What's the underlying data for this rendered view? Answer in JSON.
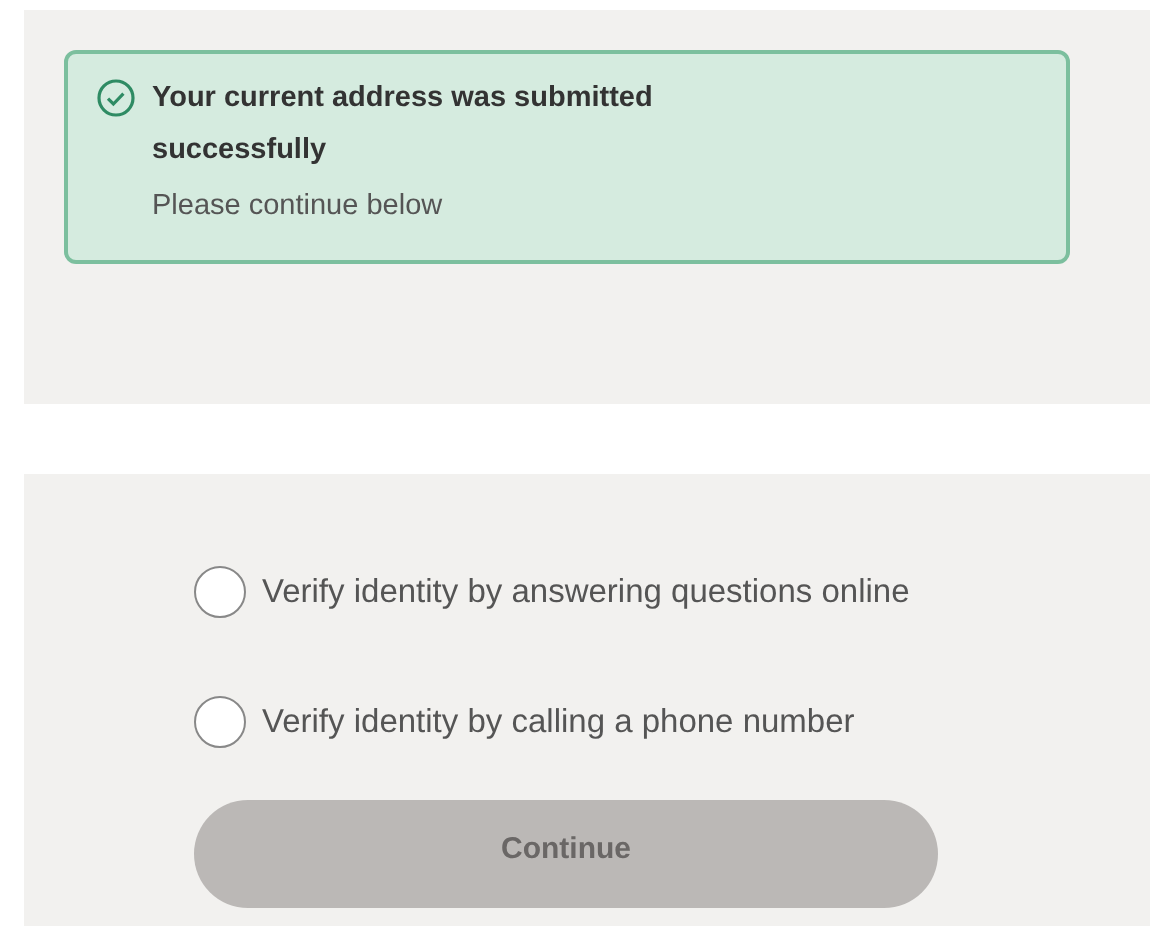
{
  "alert": {
    "title": "Your current address was submitted successfully",
    "message": "Please continue below"
  },
  "options": [
    {
      "label": "Verify identity by answering questions online",
      "selected": false
    },
    {
      "label": "Verify identity by calling a phone number",
      "selected": false
    }
  ],
  "continue_button": {
    "label": "Continue",
    "disabled": true
  }
}
